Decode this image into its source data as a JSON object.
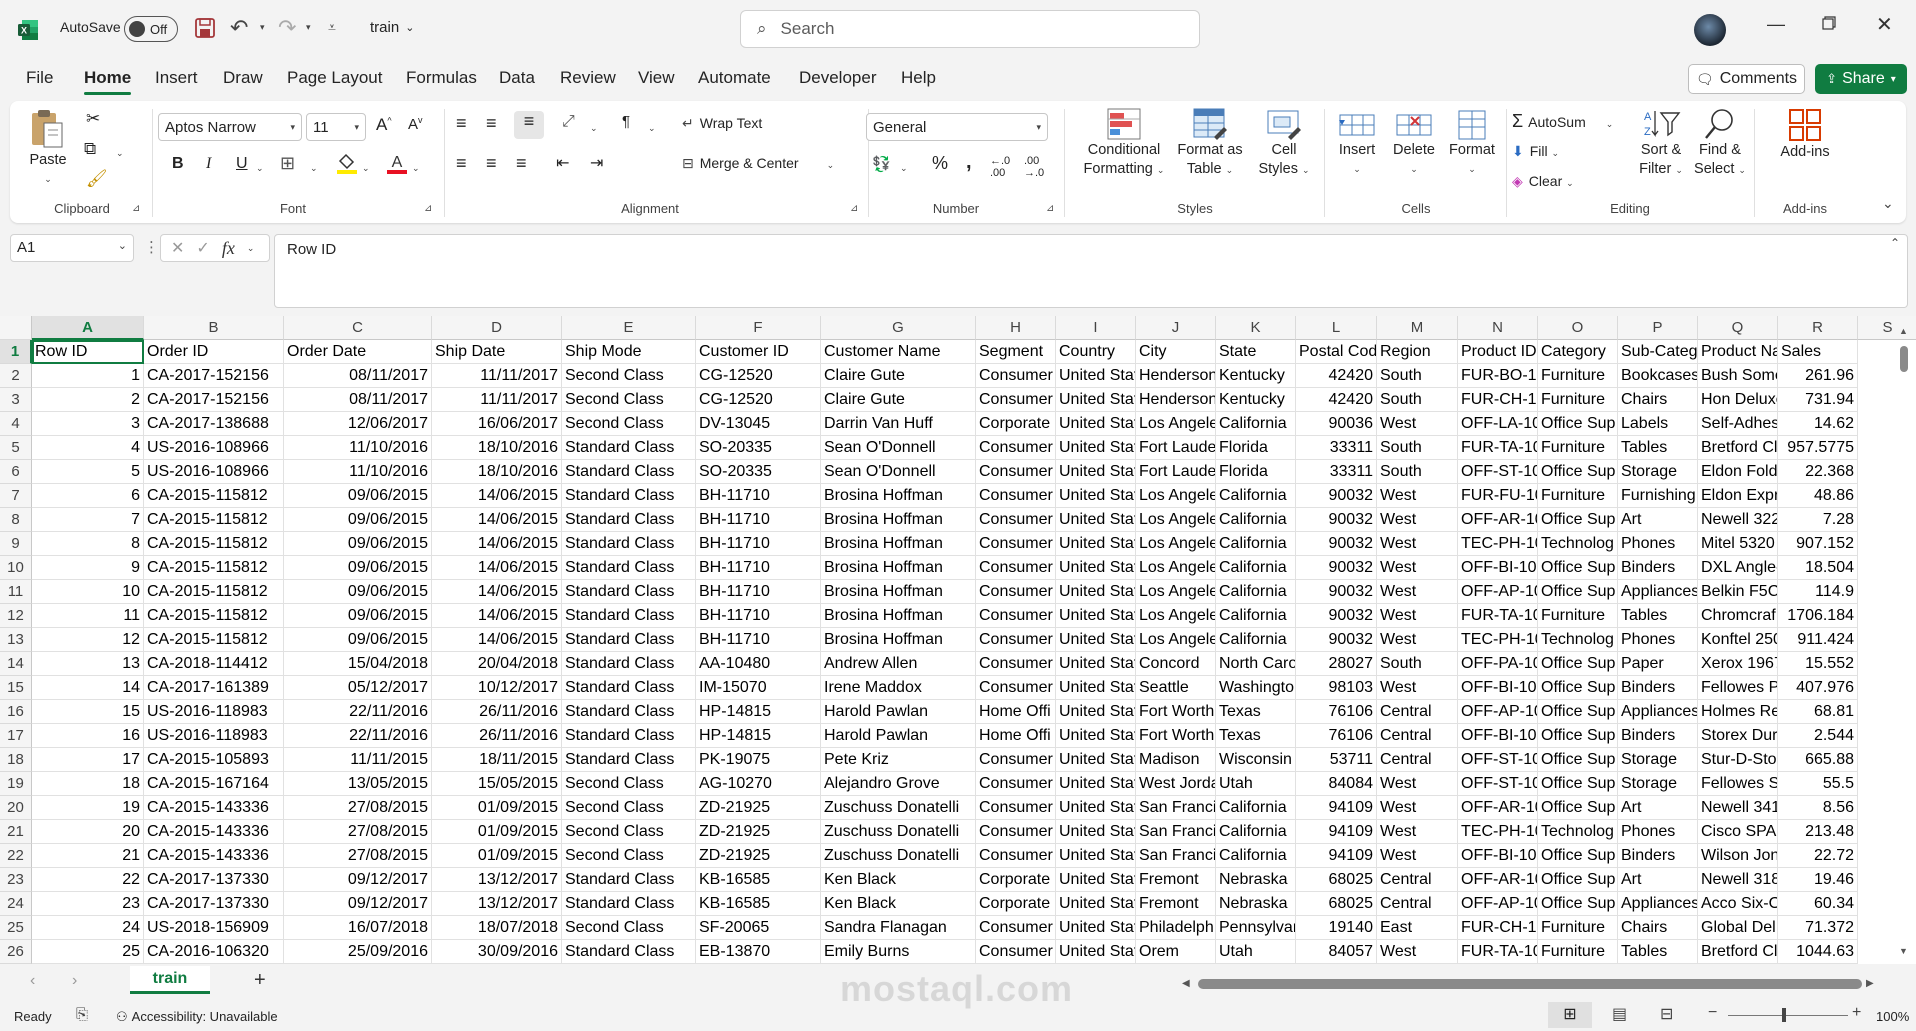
{
  "title_bar": {
    "autosave_label": "AutoSave",
    "autosave_state": "Off",
    "file_name": "train",
    "search_placeholder": "Search"
  },
  "menus": [
    "File",
    "Home",
    "Insert",
    "Draw",
    "Page Layout",
    "Formulas",
    "Data",
    "Review",
    "View",
    "Automate",
    "Developer",
    "Help"
  ],
  "comments_label": "Comments",
  "share_label": "Share",
  "ribbon": {
    "clipboard": {
      "label": "Clipboard",
      "paste": "Paste"
    },
    "font": {
      "label": "Font",
      "family": "Aptos Narrow",
      "size": "11"
    },
    "alignment": {
      "label": "Alignment",
      "wrap": "Wrap Text",
      "merge": "Merge & Center"
    },
    "number": {
      "label": "Number",
      "format": "General"
    },
    "styles": {
      "label": "Styles",
      "cond1": "Conditional",
      "cond2": "Formatting",
      "fmt1": "Format as",
      "fmt2": "Table",
      "cell1": "Cell",
      "cell2": "Styles"
    },
    "cells": {
      "label": "Cells",
      "insert": "Insert",
      "delete": "Delete",
      "format": "Format"
    },
    "editing": {
      "label": "Editing",
      "autosum": "AutoSum",
      "fill": "Fill",
      "clear": "Clear",
      "sort1": "Sort &",
      "sort2": "Filter",
      "find1": "Find &",
      "find2": "Select"
    },
    "addins": {
      "label": "Add-ins",
      "addins": "Add-ins"
    }
  },
  "formula_bar": {
    "name_box": "A1",
    "fx": "fx",
    "content": "Row ID"
  },
  "columns": [
    "A",
    "B",
    "C",
    "D",
    "E",
    "F",
    "G",
    "H",
    "I",
    "J",
    "K",
    "L",
    "M",
    "N",
    "O",
    "P",
    "Q",
    "R",
    "S"
  ],
  "header_row": [
    "Row ID",
    "Order ID",
    "Order Date",
    "Ship Date",
    "Ship Mode",
    "Customer ID",
    "Customer Name",
    "Segment",
    "Country",
    "City",
    "State",
    "Postal Cod",
    "Region",
    "Product ID",
    "Category",
    "Sub-Categ",
    "Product Na",
    "Sales"
  ],
  "rows": [
    [
      "1",
      "CA-2017-152156",
      "08/11/2017",
      "11/11/2017",
      "Second Class",
      "CG-12520",
      "Claire Gute",
      "Consumer",
      "United Stat",
      "Henderson",
      "Kentucky",
      "42420",
      "South",
      "FUR-BO-10",
      "Furniture",
      "Bookcases",
      "Bush Some",
      "261.96"
    ],
    [
      "2",
      "CA-2017-152156",
      "08/11/2017",
      "11/11/2017",
      "Second Class",
      "CG-12520",
      "Claire Gute",
      "Consumer",
      "United Stat",
      "Henderson",
      "Kentucky",
      "42420",
      "South",
      "FUR-CH-10",
      "Furniture",
      "Chairs",
      "Hon Deluxe",
      "731.94"
    ],
    [
      "3",
      "CA-2017-138688",
      "12/06/2017",
      "16/06/2017",
      "Second Class",
      "DV-13045",
      "Darrin Van Huff",
      "Corporate",
      "United Stat",
      "Los Angele",
      "California",
      "90036",
      "West",
      "OFF-LA-10",
      "Office Sup",
      "Labels",
      "Self-Adhes",
      "14.62"
    ],
    [
      "4",
      "US-2016-108966",
      "11/10/2016",
      "18/10/2016",
      "Standard Class",
      "SO-20335",
      "Sean O'Donnell",
      "Consumer",
      "United Stat",
      "Fort Laude",
      "Florida",
      "33311",
      "South",
      "FUR-TA-10",
      "Furniture",
      "Tables",
      "Bretford Cl",
      "957.5775"
    ],
    [
      "5",
      "US-2016-108966",
      "11/10/2016",
      "18/10/2016",
      "Standard Class",
      "SO-20335",
      "Sean O'Donnell",
      "Consumer",
      "United Stat",
      "Fort Laude",
      "Florida",
      "33311",
      "South",
      "OFF-ST-10",
      "Office Sup",
      "Storage",
      "Eldon Fold",
      "22.368"
    ],
    [
      "6",
      "CA-2015-115812",
      "09/06/2015",
      "14/06/2015",
      "Standard Class",
      "BH-11710",
      "Brosina Hoffman",
      "Consumer",
      "United Stat",
      "Los Angele",
      "California",
      "90032",
      "West",
      "FUR-FU-10",
      "Furniture",
      "Furnishing",
      "Eldon Expr",
      "48.86"
    ],
    [
      "7",
      "CA-2015-115812",
      "09/06/2015",
      "14/06/2015",
      "Standard Class",
      "BH-11710",
      "Brosina Hoffman",
      "Consumer",
      "United Stat",
      "Los Angele",
      "California",
      "90032",
      "West",
      "OFF-AR-10",
      "Office Sup",
      "Art",
      "Newell 322",
      "7.28"
    ],
    [
      "8",
      "CA-2015-115812",
      "09/06/2015",
      "14/06/2015",
      "Standard Class",
      "BH-11710",
      "Brosina Hoffman",
      "Consumer",
      "United Stat",
      "Los Angele",
      "California",
      "90032",
      "West",
      "TEC-PH-10",
      "Technolog",
      "Phones",
      "Mitel 5320",
      "907.152"
    ],
    [
      "9",
      "CA-2015-115812",
      "09/06/2015",
      "14/06/2015",
      "Standard Class",
      "BH-11710",
      "Brosina Hoffman",
      "Consumer",
      "United Stat",
      "Los Angele",
      "California",
      "90032",
      "West",
      "OFF-BI-10",
      "Office Sup",
      "Binders",
      "DXL Angle-",
      "18.504"
    ],
    [
      "10",
      "CA-2015-115812",
      "09/06/2015",
      "14/06/2015",
      "Standard Class",
      "BH-11710",
      "Brosina Hoffman",
      "Consumer",
      "United Stat",
      "Los Angele",
      "California",
      "90032",
      "West",
      "OFF-AP-10",
      "Office Sup",
      "Appliances",
      "Belkin F5C",
      "114.9"
    ],
    [
      "11",
      "CA-2015-115812",
      "09/06/2015",
      "14/06/2015",
      "Standard Class",
      "BH-11710",
      "Brosina Hoffman",
      "Consumer",
      "United Stat",
      "Los Angele",
      "California",
      "90032",
      "West",
      "FUR-TA-10",
      "Furniture",
      "Tables",
      "Chromcraf",
      "1706.184"
    ],
    [
      "12",
      "CA-2015-115812",
      "09/06/2015",
      "14/06/2015",
      "Standard Class",
      "BH-11710",
      "Brosina Hoffman",
      "Consumer",
      "United Stat",
      "Los Angele",
      "California",
      "90032",
      "West",
      "TEC-PH-10",
      "Technolog",
      "Phones",
      "Konftel 250",
      "911.424"
    ],
    [
      "13",
      "CA-2018-114412",
      "15/04/2018",
      "20/04/2018",
      "Standard Class",
      "AA-10480",
      "Andrew Allen",
      "Consumer",
      "United Stat",
      "Concord",
      "North Caro",
      "28027",
      "South",
      "OFF-PA-10",
      "Office Sup",
      "Paper",
      "Xerox 1967",
      "15.552"
    ],
    [
      "14",
      "CA-2017-161389",
      "05/12/2017",
      "10/12/2017",
      "Standard Class",
      "IM-15070",
      "Irene Maddox",
      "Consumer",
      "United Stat",
      "Seattle",
      "Washingto",
      "98103",
      "West",
      "OFF-BI-10",
      "Office Sup",
      "Binders",
      "Fellowes P",
      "407.976"
    ],
    [
      "15",
      "US-2016-118983",
      "22/11/2016",
      "26/11/2016",
      "Standard Class",
      "HP-14815",
      "Harold Pawlan",
      "Home Offi",
      "United Stat",
      "Fort Worth",
      "Texas",
      "76106",
      "Central",
      "OFF-AP-10",
      "Office Sup",
      "Appliances",
      "Holmes Re",
      "68.81"
    ],
    [
      "16",
      "US-2016-118983",
      "22/11/2016",
      "26/11/2016",
      "Standard Class",
      "HP-14815",
      "Harold Pawlan",
      "Home Offi",
      "United Stat",
      "Fort Worth",
      "Texas",
      "76106",
      "Central",
      "OFF-BI-10",
      "Office Sup",
      "Binders",
      "Storex Dur",
      "2.544"
    ],
    [
      "17",
      "CA-2015-105893",
      "11/11/2015",
      "18/11/2015",
      "Standard Class",
      "PK-19075",
      "Pete Kriz",
      "Consumer",
      "United Stat",
      "Madison",
      "Wisconsin",
      "53711",
      "Central",
      "OFF-ST-10",
      "Office Sup",
      "Storage",
      "Stur-D-Sto",
      "665.88"
    ],
    [
      "18",
      "CA-2015-167164",
      "13/05/2015",
      "15/05/2015",
      "Second Class",
      "AG-10270",
      "Alejandro Grove",
      "Consumer",
      "United Stat",
      "West Jorda",
      "Utah",
      "84084",
      "West",
      "OFF-ST-10",
      "Office Sup",
      "Storage",
      "Fellowes S",
      "55.5"
    ],
    [
      "19",
      "CA-2015-143336",
      "27/08/2015",
      "01/09/2015",
      "Second Class",
      "ZD-21925",
      "Zuschuss Donatelli",
      "Consumer",
      "United Stat",
      "San Franci",
      "California",
      "94109",
      "West",
      "OFF-AR-10",
      "Office Sup",
      "Art",
      "Newell 341",
      "8.56"
    ],
    [
      "20",
      "CA-2015-143336",
      "27/08/2015",
      "01/09/2015",
      "Second Class",
      "ZD-21925",
      "Zuschuss Donatelli",
      "Consumer",
      "United Stat",
      "San Franci",
      "California",
      "94109",
      "West",
      "TEC-PH-10",
      "Technolog",
      "Phones",
      "Cisco SPA",
      "213.48"
    ],
    [
      "21",
      "CA-2015-143336",
      "27/08/2015",
      "01/09/2015",
      "Second Class",
      "ZD-21925",
      "Zuschuss Donatelli",
      "Consumer",
      "United Stat",
      "San Franci",
      "California",
      "94109",
      "West",
      "OFF-BI-10",
      "Office Sup",
      "Binders",
      "Wilson Jon",
      "22.72"
    ],
    [
      "22",
      "CA-2017-137330",
      "09/12/2017",
      "13/12/2017",
      "Standard Class",
      "KB-16585",
      "Ken Black",
      "Corporate",
      "United Stat",
      "Fremont",
      "Nebraska",
      "68025",
      "Central",
      "OFF-AR-10",
      "Office Sup",
      "Art",
      "Newell 318",
      "19.46"
    ],
    [
      "23",
      "CA-2017-137330",
      "09/12/2017",
      "13/12/2017",
      "Standard Class",
      "KB-16585",
      "Ken Black",
      "Corporate",
      "United Stat",
      "Fremont",
      "Nebraska",
      "68025",
      "Central",
      "OFF-AP-10",
      "Office Sup",
      "Appliances",
      "Acco Six-O",
      "60.34"
    ],
    [
      "24",
      "US-2018-156909",
      "16/07/2018",
      "18/07/2018",
      "Second Class",
      "SF-20065",
      "Sandra Flanagan",
      "Consumer",
      "United Stat",
      "Philadelph",
      "Pennsylvar",
      "19140",
      "East",
      "FUR-CH-10",
      "Furniture",
      "Chairs",
      "Global Del",
      "71.372"
    ],
    [
      "25",
      "CA-2016-106320",
      "25/09/2016",
      "30/09/2016",
      "Standard Class",
      "EB-13870",
      "Emily Burns",
      "Consumer",
      "United Stat",
      "Orem",
      "Utah",
      "84057",
      "West",
      "FUR-TA-10",
      "Furniture",
      "Tables",
      "Bretford Cl",
      "1044.63"
    ]
  ],
  "sheet_tabs": [
    "train"
  ],
  "status": {
    "ready": "Ready",
    "accessibility": "Accessibility: Unavailable",
    "zoom": "100%"
  },
  "watermark": "mostaql.com"
}
